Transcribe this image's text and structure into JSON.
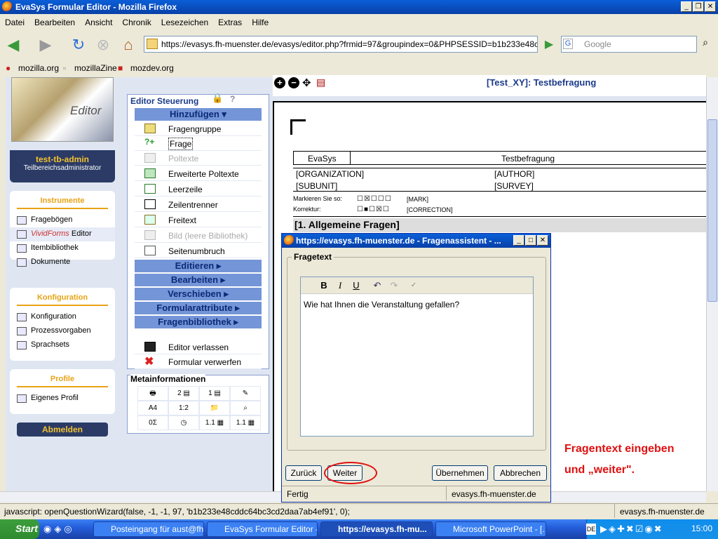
{
  "window": {
    "title": "EvaSys Formular Editor - Mozilla Firefox"
  },
  "menu": [
    "Datei",
    "Bearbeiten",
    "Ansicht",
    "Chronik",
    "Lesezeichen",
    "Extras",
    "Hilfe"
  ],
  "nav": {
    "url": "https://evasys.fh-muenster.de/evasys/editor.php?frmid=97&groupindex=0&PHPSESSID=b1b233e48c",
    "search_placeholder": "Google"
  },
  "bookmarks": [
    "mozilla.org",
    "mozillaZine",
    "mozdev.org"
  ],
  "sidebar": {
    "logo_text": "Editor",
    "user_name": "test-tb-admin",
    "user_role": "Teilbereichsadministrator",
    "instrumente": {
      "title": "Instrumente",
      "items": [
        "Fragebögen",
        "VividForms",
        "Editor",
        "Itembibliothek",
        "Dokumente"
      ]
    },
    "konfiguration": {
      "title": "Konfiguration",
      "items": [
        "Konfiguration",
        "Prozessvorgaben",
        "Sprachsets"
      ]
    },
    "profile": {
      "title": "Profile",
      "items": [
        "Eigenes Profil"
      ]
    },
    "logout": "Abmelden"
  },
  "editor": {
    "title": "Editor Steuerung",
    "help": "?",
    "hinzufuegen": "Hinzufügen",
    "items": [
      "Fragengruppe",
      "Frage",
      "Poltexte",
      "Erweiterte Poltexte",
      "Leerzeile",
      "Zeilentrenner",
      "Freitext",
      "Bild (leere Bibliothek)",
      "Seitenumbruch"
    ],
    "menus": [
      "Editieren",
      "Bearbeiten",
      "Verschieben",
      "Formularattribute",
      "Fragenbibliothek"
    ],
    "exit": "Editor verlassen",
    "discard": "Formular verwerfen"
  },
  "meta": {
    "title": "Metainformationen",
    "cells": [
      "",
      "2",
      "1",
      "",
      "A4",
      "1:2",
      "",
      "",
      "0",
      "",
      "1.1",
      "1.1"
    ]
  },
  "doc": {
    "title": "[Test_XY]: Testbefragung",
    "header_left": "EvaSys",
    "header_right": "Testbefragung",
    "org": "[ORGANIZATION]",
    "author": "[AUTHOR]",
    "subunit": "[SUBUNIT]",
    "survey": "[SURVEY]",
    "mark_label": "Markieren Sie so:",
    "mark_tag": "[MARK]",
    "corr_label": "Korrektur:",
    "corr_tag": "[CORRECTION]",
    "section": "[1. Allgemeine Fragen]"
  },
  "dialog": {
    "title": "https://evasys.fh-muenster.de - Fragenassistent - ...",
    "group": "Fragetext",
    "text": "Wie hat Ihnen die Veranstaltung gefallen?",
    "back": "Zurück",
    "next": "Weiter",
    "apply": "Übernehmen",
    "cancel": "Abbrechen",
    "status": "Fertig",
    "status_host": "evasys.fh-muenster.de"
  },
  "annotation": {
    "line1": "Fragentext eingeben",
    "line2": "und „weiter\"."
  },
  "statusbar": {
    "text": "javascript: openQuestionWizard(false, -1, -1, 97, 'b1b233e48cddc64bc3cd2daa7ab4ef91', 0);",
    "host": "evasys.fh-muenster.de"
  },
  "taskbar": {
    "start": "Start",
    "tasks": [
      "Posteingang für aust@fh...",
      "EvaSys Formular Editor -...",
      "https://evasys.fh-mu...",
      "Microsoft PowerPoint - [..."
    ],
    "lang": "DE",
    "clock": "15:00"
  }
}
